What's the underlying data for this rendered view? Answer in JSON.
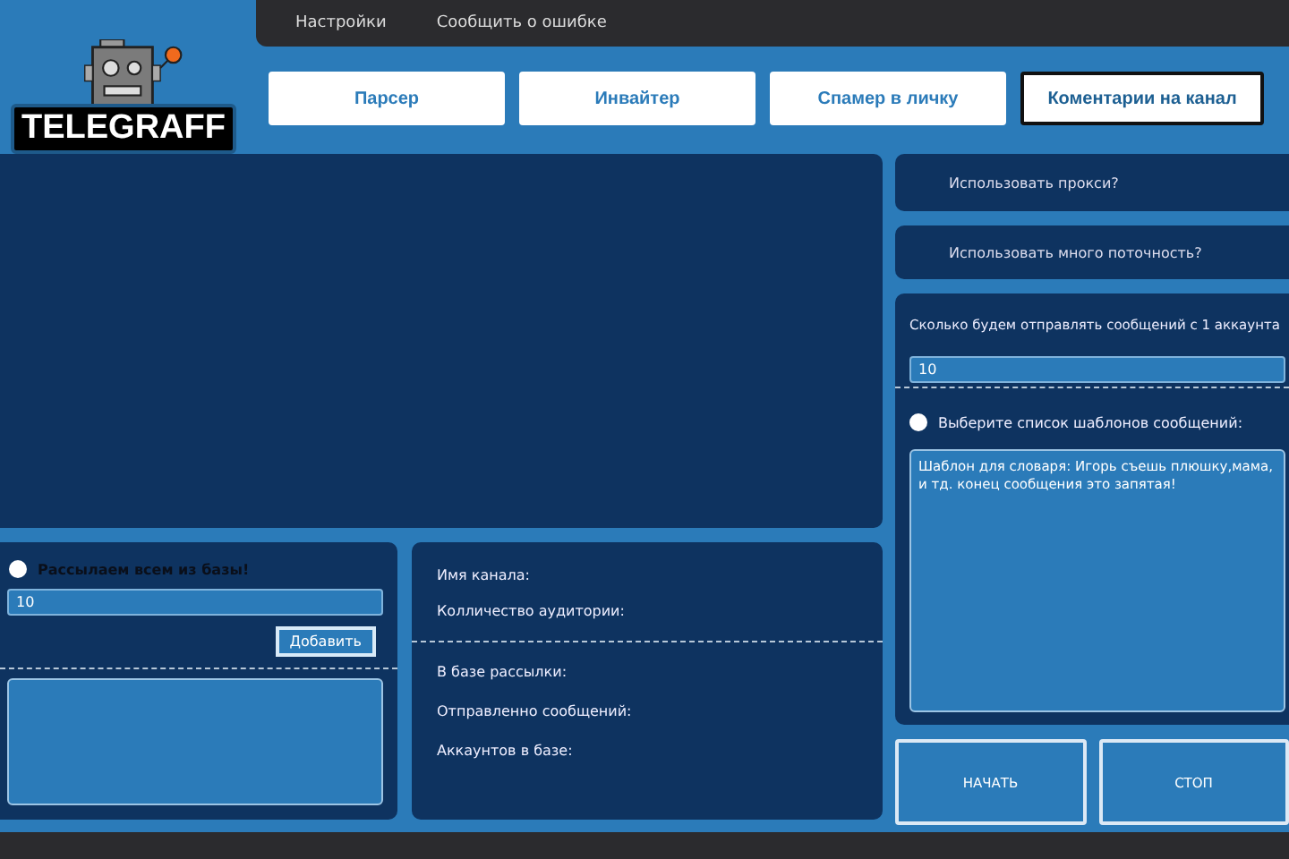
{
  "menu": [
    {
      "label": "Настройки"
    },
    {
      "label": "Сообщить о ошибке"
    }
  ],
  "logo": {
    "text": "TELEGRAFF"
  },
  "tabs": [
    {
      "label": "Парсер",
      "selected": false
    },
    {
      "label": "Инвайтер",
      "selected": false
    },
    {
      "label": "Спамер в личку",
      "selected": false
    },
    {
      "label": "Коментарии на канал",
      "selected": true
    }
  ],
  "options": [
    {
      "label": "Использовать прокси?"
    },
    {
      "label": "Использовать много поточность?"
    }
  ],
  "messages_panel": {
    "count_label": "Сколько будем отправлять сообщений с 1 аккаунта",
    "count_value": "10",
    "template_radio": {
      "label": "Выберите список шаблонов сообщений:",
      "checked": false
    },
    "template_text": "Шаблон для словаря: Игорь съешь плюшку,мама, и тд. конец сообщения это запятая!"
  },
  "base_panel": {
    "radio": {
      "label": "Рассылаем всем из базы!",
      "checked": false
    },
    "value": "10",
    "add_button": "Добавить"
  },
  "info_panel": {
    "group_1": [
      "Имя канала:",
      "Колличество аудитории:"
    ],
    "group_2": [
      "В базе рассылки:",
      "Отправленно сообщений:",
      "Аккаунтов в базе:"
    ]
  },
  "actions": [
    {
      "label": "НАЧАТЬ"
    },
    {
      "label": "СТОП"
    }
  ]
}
